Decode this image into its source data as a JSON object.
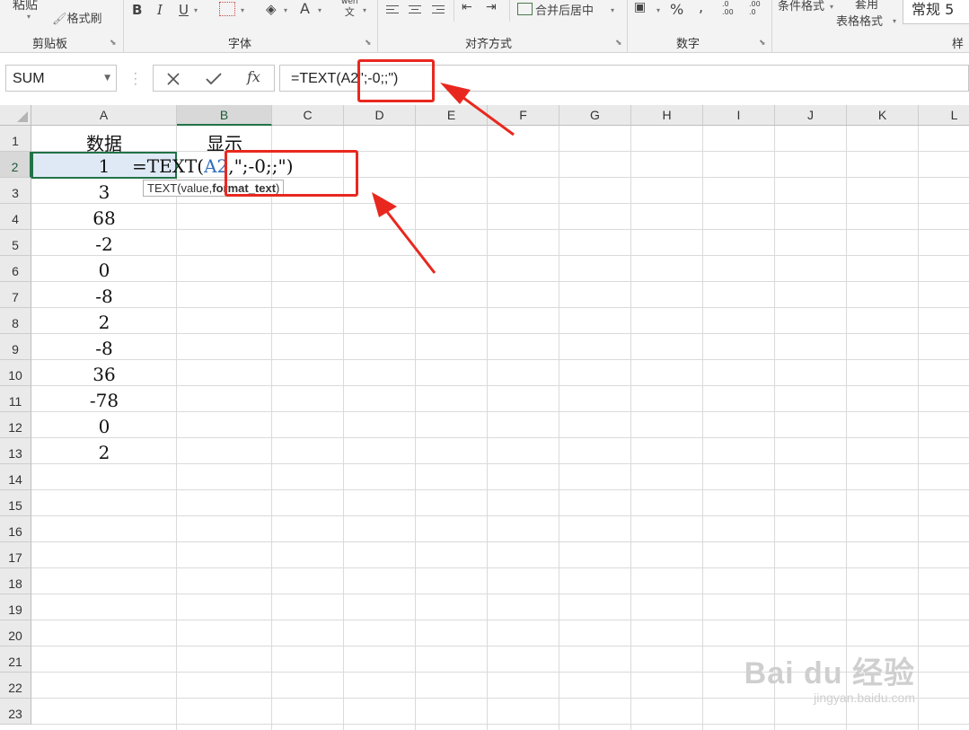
{
  "ribbon": {
    "clipboard": {
      "paste_label": "粘贴",
      "format_painter_label": "格式刷",
      "group_label": "剪贴板"
    },
    "font": {
      "bold": "B",
      "italic": "I",
      "underline": "U",
      "font_color_glyph": "A",
      "phonetic_glyph_top": "wén",
      "phonetic_glyph_bottom": "文",
      "group_label": "字体"
    },
    "alignment": {
      "merge_center_label": "合并后居中",
      "group_label": "对齐方式"
    },
    "number": {
      "percent_glyph": "%",
      "inc_decimal_glyph": ".0 .00",
      "dec_decimal_glyph": ".00 .0",
      "group_label": "数字"
    },
    "styles": {
      "conditional_format_label": "条件格式",
      "table_format_label_top": "套用",
      "table_format_label": "表格格式",
      "style_box_label": "常规 5",
      "group_label": "样式"
    }
  },
  "formula_bar": {
    "name_box": "SUM",
    "fx_label": "fx",
    "formula": "=TEXT(A2\";-0;;\")"
  },
  "grid": {
    "columns": [
      "A",
      "B",
      "C",
      "D",
      "E",
      "F",
      "G",
      "H",
      "I",
      "J",
      "K",
      "L"
    ],
    "rows": [
      "1",
      "2",
      "3",
      "4",
      "5",
      "6",
      "7",
      "8",
      "9",
      "10",
      "11",
      "12",
      "13",
      "14",
      "15",
      "16",
      "17",
      "18",
      "19",
      "20",
      "21",
      "22",
      "23"
    ],
    "header_a": "数据",
    "header_b": "显示",
    "values": [
      "1",
      "3",
      "68",
      "-2",
      "0",
      "-8",
      "2",
      "-8",
      "36",
      "-78",
      "0",
      "2"
    ],
    "edit_text": {
      "prefix": "=TEXT(",
      "ref": "A2",
      "comma": ",",
      "format": "\";-0;;\")"
    },
    "tooltip": {
      "prefix": "TEXT(value,",
      "bold": "format_text",
      "suffix": ")"
    }
  },
  "watermark": {
    "brand": "Bai du 经验",
    "url": "jingyan.baidu.com"
  },
  "colors": {
    "highlight_red": "#e8281f",
    "excel_green": "#217346",
    "ref_blue": "#2f6fbf"
  }
}
